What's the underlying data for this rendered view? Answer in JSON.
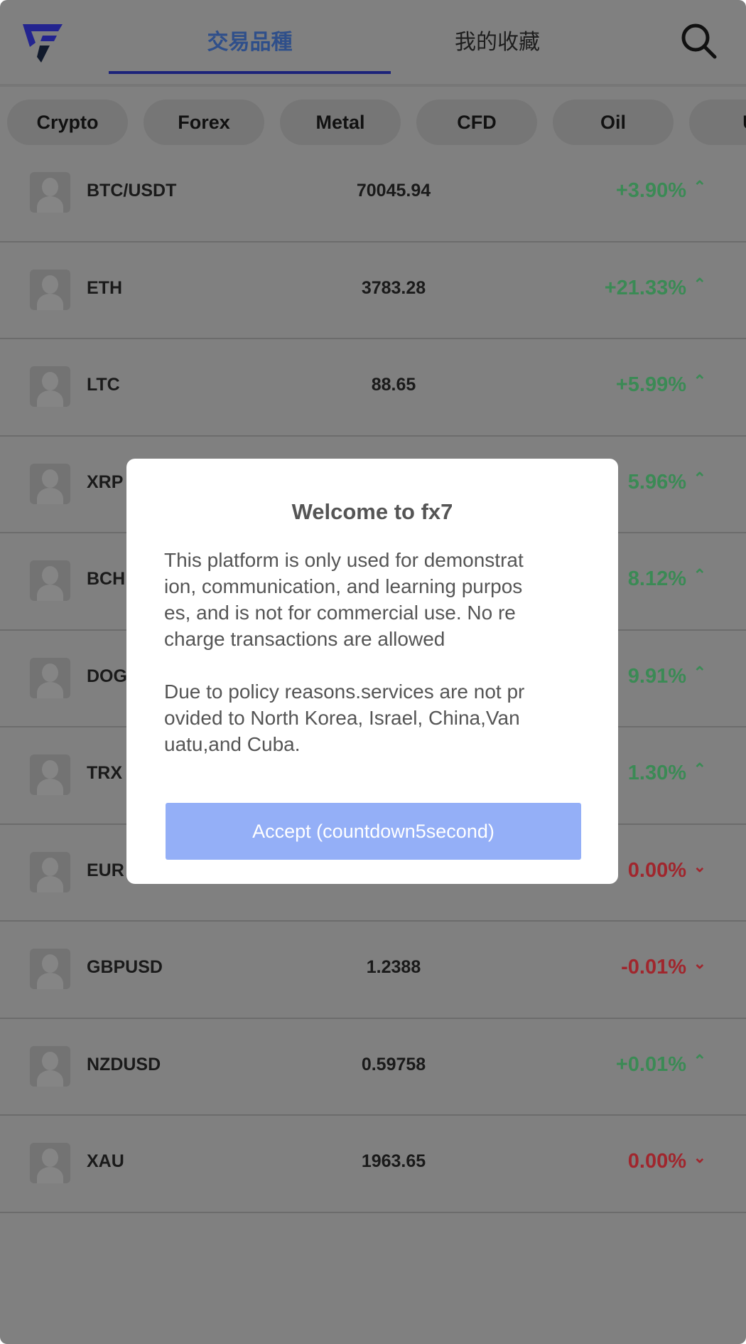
{
  "header": {
    "tabs": [
      {
        "label": "交易品種",
        "active": true
      },
      {
        "label": "我的收藏",
        "active": false
      }
    ],
    "accent": "#1c237a"
  },
  "categories": [
    "Crypto",
    "Forex",
    "Metal",
    "CFD",
    "Oil",
    "U"
  ],
  "rows": [
    {
      "symbol": "BTC/USDT",
      "price": "70045.94",
      "change": "+3.90%",
      "dir": "up"
    },
    {
      "symbol": "ETH",
      "price": "3783.28",
      "change": "+21.33%",
      "dir": "up"
    },
    {
      "symbol": "LTC",
      "price": "88.65",
      "change": "+5.99%",
      "dir": "up"
    },
    {
      "symbol": "XRP",
      "price": "",
      "change": "5.96%",
      "dir": "up"
    },
    {
      "symbol": "BCH",
      "price": "",
      "change": "8.12%",
      "dir": "up"
    },
    {
      "symbol": "DOG",
      "price": "",
      "change": "9.91%",
      "dir": "up"
    },
    {
      "symbol": "TRX",
      "price": "",
      "change": "1.30%",
      "dir": "up"
    },
    {
      "symbol": "EUR",
      "price": "",
      "change": "0.00%",
      "dir": "down"
    },
    {
      "symbol": "GBPUSD",
      "price": "1.2388",
      "change": "-0.01%",
      "dir": "down"
    },
    {
      "symbol": "NZDUSD",
      "price": "0.59758",
      "change": "+0.01%",
      "dir": "up"
    },
    {
      "symbol": "XAU",
      "price": "1963.65",
      "change": "0.00%",
      "dir": "down"
    }
  ],
  "colors": {
    "up": "#3b8a55",
    "down": "#a0262d"
  },
  "modal": {
    "title": "Welcome to fx7",
    "para1": [
      "This platform is only used for demonstrat",
      "ion, communication, and learning purpos",
      "es, and is not for commercial use. No re",
      "charge transactions are allowed"
    ],
    "para2": [
      "Due to policy reasons.services are not pr",
      "ovided to North Korea, Israel, China,Van",
      "uatu,and Cuba."
    ],
    "accept_label": "Accept (countdown5second)"
  }
}
